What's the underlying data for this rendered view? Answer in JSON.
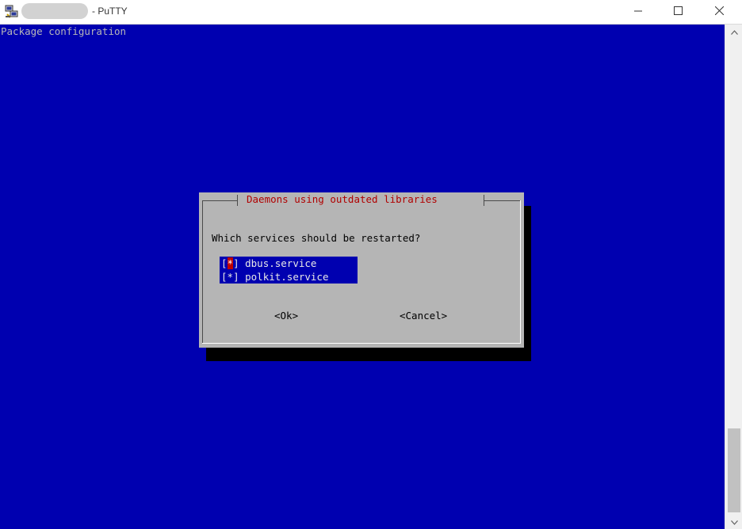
{
  "window": {
    "title_suffix": "- PuTTY",
    "controls": {
      "minimize_icon": "minimize-icon",
      "maximize_icon": "maximize-icon",
      "close_icon": "close-icon"
    }
  },
  "terminal": {
    "heading": "Package configuration",
    "background_color": "#0000b0",
    "dialog": {
      "title": "Daemons using outdated libraries",
      "question": "Which services should be restarted?",
      "services": [
        {
          "mark": "*",
          "label": "dbus.service",
          "checked": true
        },
        {
          "mark": "*",
          "label": "polkit.service",
          "checked": true
        }
      ],
      "ok_label": "<Ok>",
      "cancel_label": "<Cancel>"
    }
  },
  "colors": {
    "terminal_bg": "#0000b0",
    "dialog_bg": "#b5b5b5",
    "dialog_title": "#b00000",
    "cursor": "#c00000"
  }
}
